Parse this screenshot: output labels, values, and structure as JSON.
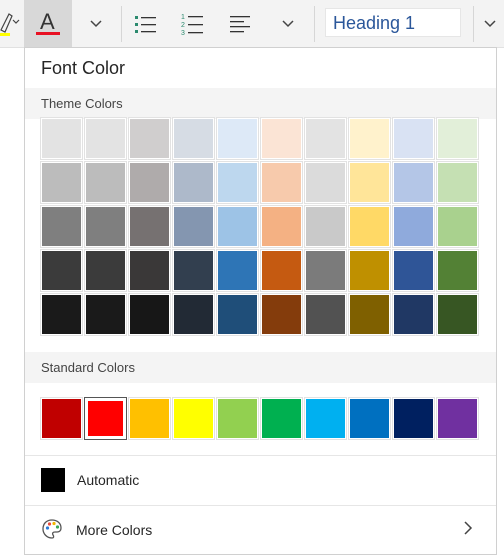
{
  "toolbar": {
    "font_color_letter": "A",
    "font_color_bar": "#e81123",
    "highlight_bar": "#ffff00",
    "heading_value": "Heading 1",
    "icons": [
      "highlighter-icon",
      "dropdown-chevron-icon",
      "font-color-icon",
      "bullet-list-icon",
      "numbered-list-icon",
      "align-icon"
    ]
  },
  "panel": {
    "title": "Font Color",
    "theme_header": "Theme Colors",
    "standard_header": "Standard Colors",
    "automatic_label": "Automatic",
    "automatic_color": "#000000",
    "more_colors_label": "More Colors",
    "theme_colors": [
      [
        "#e3e3e3",
        "#e3e3e3",
        "#d0cece",
        "#d6dce4",
        "#dde9f7",
        "#fbe4d5",
        "#e3e3e3",
        "#fff2cc",
        "#d9e2f3",
        "#e2efd9"
      ],
      [
        "#bcbcbc",
        "#bcbcbc",
        "#afabab",
        "#adb9ca",
        "#bdd7ee",
        "#f7caac",
        "#dbdbdb",
        "#ffe599",
        "#b4c6e7",
        "#c5e0b3"
      ],
      [
        "#7f7f7f",
        "#7f7f7f",
        "#767171",
        "#8496b0",
        "#9dc3e6",
        "#f4b183",
        "#c9c9c9",
        "#ffd966",
        "#8faadc",
        "#a9d18e"
      ],
      [
        "#3b3b3b",
        "#3b3b3b",
        "#3a3838",
        "#323f4f",
        "#2e75b6",
        "#c55a11",
        "#7b7b7b",
        "#bf9000",
        "#2f5597",
        "#538135"
      ],
      [
        "#1a1a1a",
        "#1a1a1a",
        "#171717",
        "#222a35",
        "#1f4e79",
        "#843c0c",
        "#525252",
        "#7f6000",
        "#203864",
        "#375623"
      ]
    ],
    "standard_colors": [
      "#c00000",
      "#ff0000",
      "#ffc000",
      "#ffff00",
      "#92d050",
      "#00b050",
      "#00b0f0",
      "#0070c0",
      "#002060",
      "#7030a0"
    ],
    "selected_standard_index": 1
  }
}
